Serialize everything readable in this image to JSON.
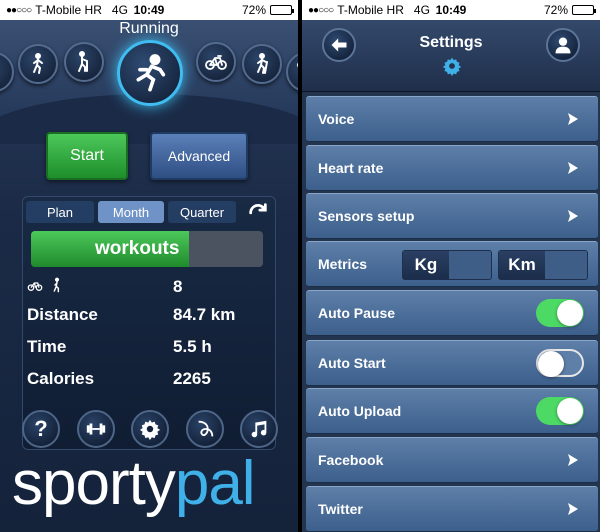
{
  "status_bar": {
    "signal_dots": "●●○○○",
    "carrier": "T-Mobile HR",
    "network": "4G",
    "time": "10:49",
    "battery": "72%",
    "battery_level": 0.72
  },
  "running_screen": {
    "title": "Running",
    "sport_icons": [
      "running-icon",
      "walking-icon",
      "nordic-walking-icon",
      "running-icon",
      "cycling-icon",
      "hiking-icon"
    ],
    "start_label": "Start",
    "advanced_label": "Advanced",
    "period_tabs": [
      "Plan",
      "Month",
      "Quarter"
    ],
    "active_period": "Month",
    "progress": {
      "label": "workouts",
      "fraction": 0.68
    },
    "stats": [
      {
        "label": "",
        "value": "8",
        "icons": [
          "cycling-icon",
          "walking-icon"
        ]
      },
      {
        "label": "Distance",
        "value": "84.7 km"
      },
      {
        "label": "Time",
        "value": "5.5 h"
      },
      {
        "label": "Calories",
        "value": "2265"
      }
    ],
    "bottom_icons": [
      "help-icon",
      "dumbbell-icon",
      "gear-icon",
      "route-icon",
      "music-icon"
    ],
    "brand": {
      "part1": "sporty",
      "part2": "pal"
    }
  },
  "settings_screen": {
    "title": "Settings",
    "rows": {
      "voice": "Voice",
      "heart_rate": "Heart rate",
      "sensors_setup": "Sensors setup",
      "metrics": "Metrics",
      "metrics_weight": "Kg",
      "metrics_distance": "Km",
      "auto_pause": "Auto Pause",
      "auto_start": "Auto Start",
      "auto_upload": "Auto Upload",
      "facebook": "Facebook",
      "twitter": "Twitter"
    },
    "toggles": {
      "auto_pause": true,
      "auto_start": false,
      "auto_upload": true
    },
    "colors": {
      "toggle_on": "#4cd964",
      "row": "#4f729c"
    }
  }
}
